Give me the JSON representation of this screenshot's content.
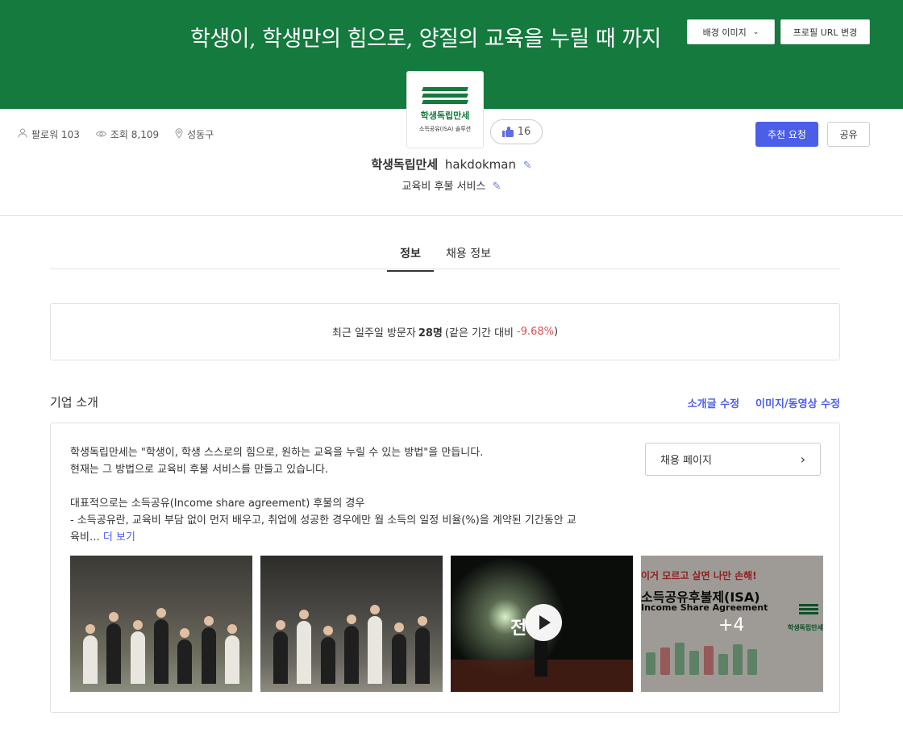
{
  "banner": {
    "text": "학생이, 학생만의 힘으로, 양질의 교육을 누릴 때 까지",
    "bg_image_button": "배경 이미지",
    "profile_url_button": "프로필 URL 변경",
    "color": "#147a3d"
  },
  "logo": {
    "title": "학생독립만세",
    "subtitle": "소득공유(ISA) 솔루션"
  },
  "meta": {
    "followers": "팔로워 103",
    "views": "조회 8,109",
    "location": "성동구"
  },
  "like": {
    "count": "16"
  },
  "actions": {
    "recommend": "추천 요청",
    "share": "공유"
  },
  "company": {
    "name": "학생독립만세",
    "handle": "hakdokman",
    "description": "교육비 후불 서비스"
  },
  "tabs": [
    {
      "label": "정보"
    },
    {
      "label": "채용 정보"
    }
  ],
  "visitors": {
    "prefix": "최근 일주일 방문자",
    "count": "28명",
    "compare_prefix": "(같은 기간 대비",
    "change": "-9.68%",
    "suffix": ")"
  },
  "intro": {
    "section_title": "기업 소개",
    "edit_intro": "소개글 수정",
    "edit_media": "이미지/동영상 수정",
    "lines": [
      "학생독립만세는 \"학생이, 학생 스스로의 힘으로, 원하는 교육을 누릴 수 있는 방법\"을 만듭니다.",
      "현재는 그 방법으로 교육비 후불 서비스를 만들고 있습니다.",
      "대표적으로는 소득공유(Income share agreement) 후불의 경우",
      "- 소득공유란, 교육비 부담 없이 먼저 배우고, 취업에 성공한 경우에만 월 소득의 일정 비율(%)을 계약된 기간동안 교",
      "육비…"
    ],
    "more": "더 보기",
    "job_page_button": "채용 페이지"
  },
  "media": {
    "video_word": "전",
    "isa_red": "이거 모르고 살면 나만 손해!",
    "isa_title": "소득공유후불제(ISA)",
    "isa_sub": "Income Share Agreement",
    "isa_logo_text": "학생독립만세",
    "more_count": "+4"
  }
}
